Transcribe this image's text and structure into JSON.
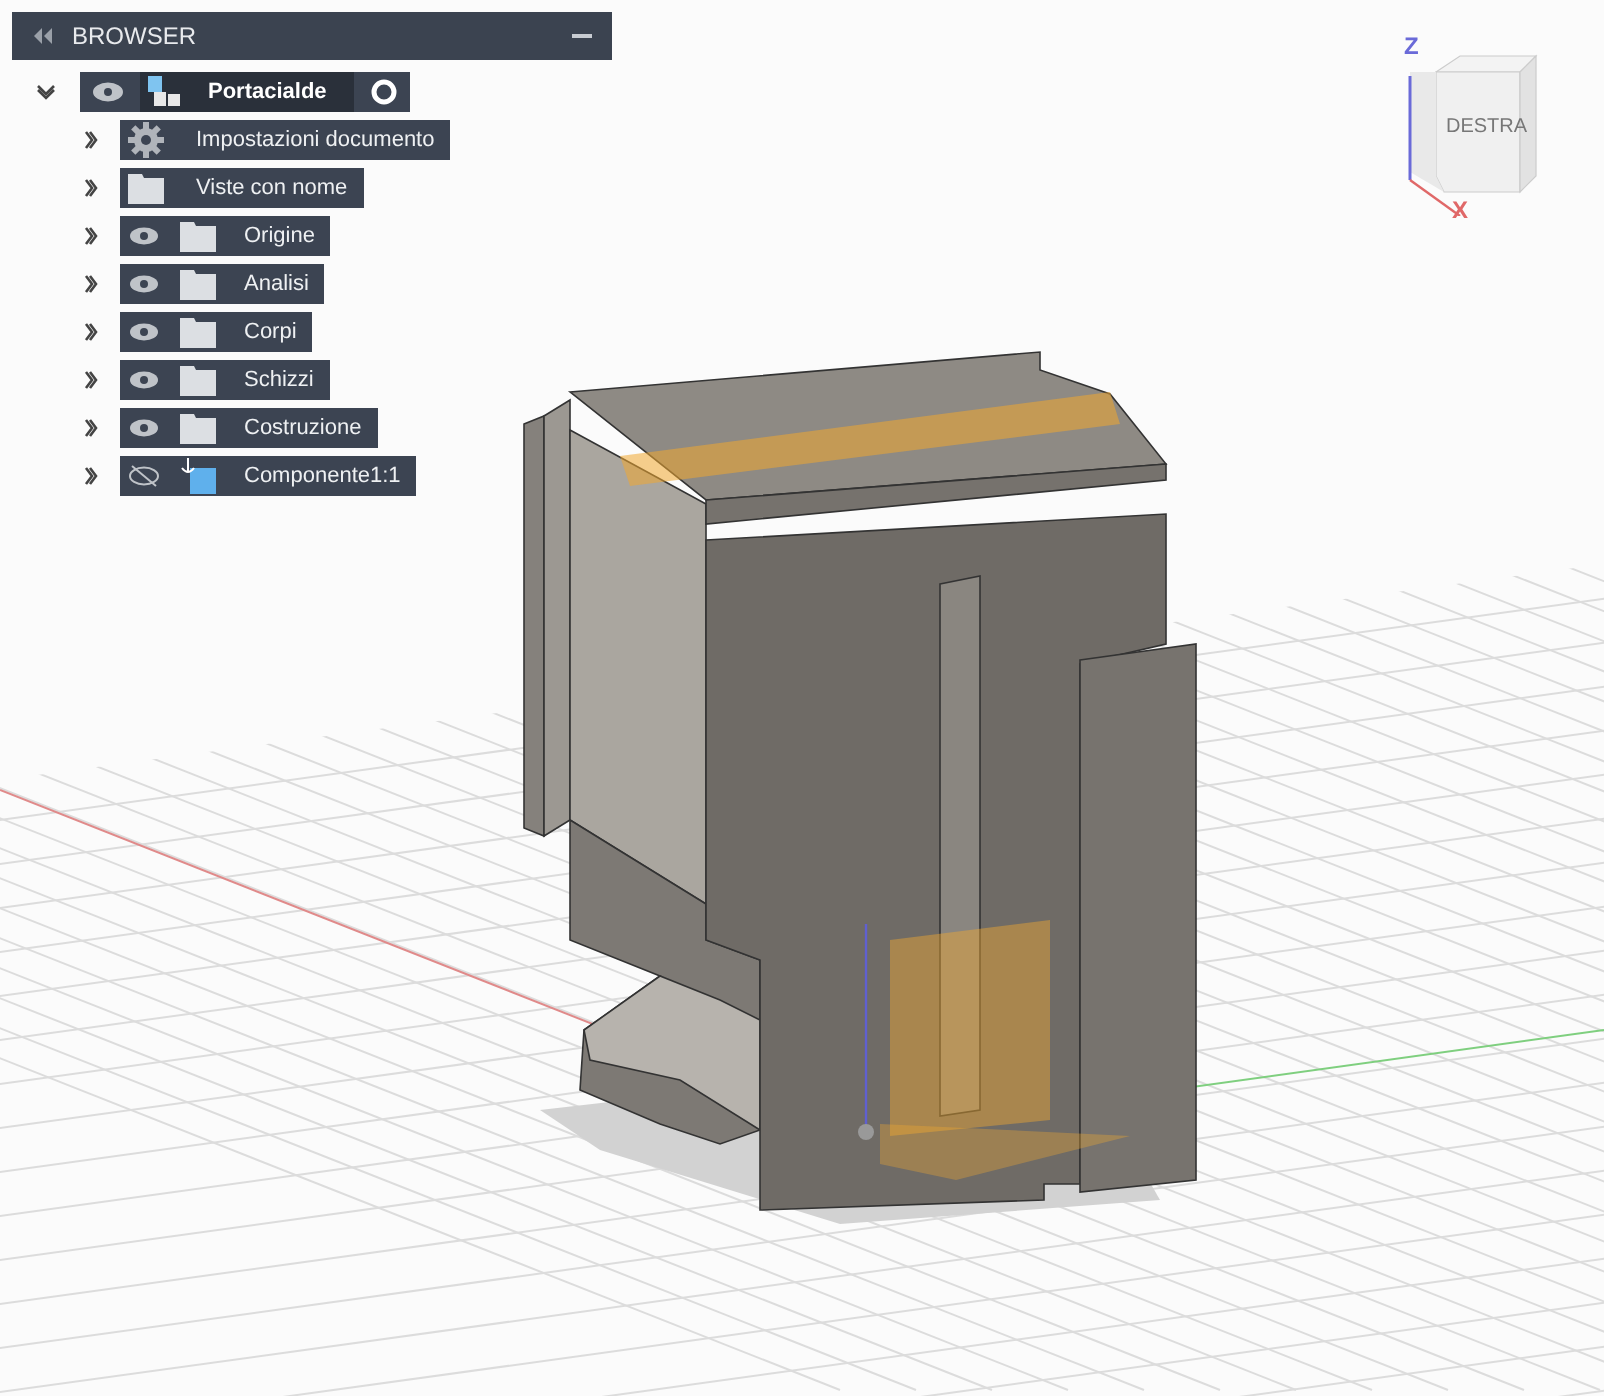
{
  "browser": {
    "title": "BROWSER",
    "root": {
      "label": "Portacialde",
      "expanded": true,
      "visible": true,
      "active": true,
      "children": [
        {
          "label": "Impostazioni documento",
          "kind": "settings",
          "eye_toggle": false,
          "expanded": false
        },
        {
          "label": "Viste con nome",
          "kind": "folder",
          "eye_toggle": false,
          "expanded": false
        },
        {
          "label": "Origine",
          "kind": "folder",
          "eye_toggle": true,
          "visible": true,
          "expanded": false
        },
        {
          "label": "Analisi",
          "kind": "folder",
          "eye_toggle": true,
          "visible": true,
          "expanded": false
        },
        {
          "label": "Corpi",
          "kind": "folder",
          "eye_toggle": true,
          "visible": true,
          "expanded": false
        },
        {
          "label": "Schizzi",
          "kind": "folder",
          "eye_toggle": true,
          "visible": true,
          "expanded": false
        },
        {
          "label": "Costruzione",
          "kind": "folder",
          "eye_toggle": true,
          "visible": true,
          "expanded": false
        },
        {
          "label": "Componente1:1",
          "kind": "component",
          "eye_toggle": true,
          "visible": false,
          "expanded": false
        }
      ]
    }
  },
  "view_cube": {
    "face": "DESTRA",
    "z_label": "Z",
    "x_label": "X"
  }
}
